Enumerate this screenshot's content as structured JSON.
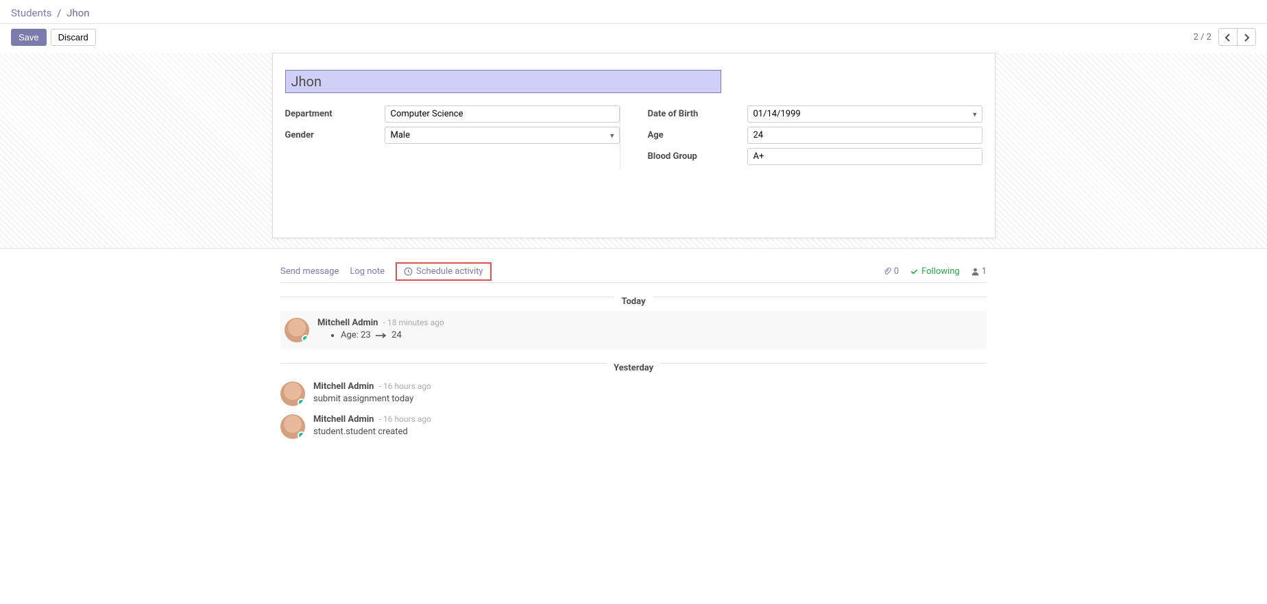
{
  "breadcrumb": {
    "root": "Students",
    "current": "Jhon"
  },
  "buttons": {
    "save": "Save",
    "discard": "Discard"
  },
  "pager": {
    "text": "2 / 2"
  },
  "form": {
    "name": "Jhon",
    "labels": {
      "department": "Department",
      "gender": "Gender",
      "dob": "Date of Birth",
      "age": "Age",
      "blood_group": "Blood Group"
    },
    "values": {
      "department": "Computer Science",
      "gender": "Male",
      "dob": "01/14/1999",
      "age": "24",
      "blood_group": "A+"
    }
  },
  "chatter": {
    "send_message": "Send message",
    "log_note": "Log note",
    "schedule_activity": "Schedule activity",
    "attachment_count": "0",
    "following": "Following",
    "follower_count": "1"
  },
  "messages": {
    "today_label": "Today",
    "yesterday_label": "Yesterday",
    "items": [
      {
        "group": "today",
        "author": "Mitchell Admin",
        "time": "- 18 minutes ago",
        "type": "change",
        "field": "Age:",
        "old": "23",
        "new": "24"
      },
      {
        "group": "yesterday",
        "author": "Mitchell Admin",
        "time": "- 16 hours ago",
        "type": "text",
        "text": "submit assignment today"
      },
      {
        "group": "yesterday",
        "author": "Mitchell Admin",
        "time": "- 16 hours ago",
        "type": "text",
        "text": "student.student created"
      }
    ]
  }
}
